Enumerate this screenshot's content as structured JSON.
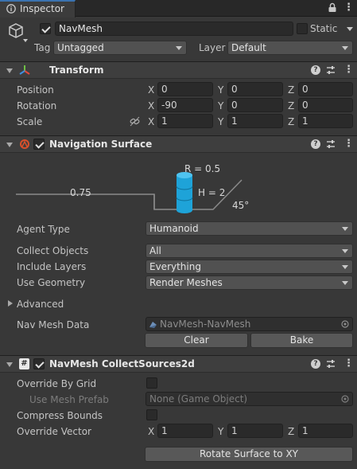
{
  "window": {
    "tab_title": "Inspector"
  },
  "gameobject": {
    "active": true,
    "name": "NavMesh",
    "static_label": "Static",
    "static_checked": false,
    "tag_label": "Tag",
    "tag_value": "Untagged",
    "layer_label": "Layer",
    "layer_value": "Default"
  },
  "transform": {
    "title": "Transform",
    "position": {
      "label": "Position",
      "x": "0",
      "y": "0",
      "z": "0"
    },
    "rotation": {
      "label": "Rotation",
      "x": "-90",
      "y": "0",
      "z": "0"
    },
    "scale": {
      "label": "Scale",
      "x": "1",
      "y": "1",
      "z": "1"
    },
    "axis_x": "X",
    "axis_y": "Y",
    "axis_z": "Z"
  },
  "nav_surface": {
    "title": "Navigation Surface",
    "enabled": true,
    "diagram": {
      "radius": "R = 0.5",
      "height": "H = 2",
      "step": "0.75",
      "slope": "45°"
    },
    "agent_type": {
      "label": "Agent Type",
      "value": "Humanoid"
    },
    "collect_objects": {
      "label": "Collect Objects",
      "value": "All"
    },
    "include_layers": {
      "label": "Include Layers",
      "value": "Everything"
    },
    "use_geometry": {
      "label": "Use Geometry",
      "value": "Render Meshes"
    },
    "advanced_label": "Advanced",
    "nav_mesh_data": {
      "label": "Nav Mesh Data",
      "value": "NavMesh-NavMesh"
    },
    "clear_label": "Clear",
    "bake_label": "Bake"
  },
  "collect_sources": {
    "title": "NavMesh CollectSources2d",
    "enabled": true,
    "override_by_grid": {
      "label": "Override By Grid",
      "checked": false
    },
    "use_mesh_prefab": {
      "label": "Use Mesh Prefab",
      "value": "None (Game Object)"
    },
    "compress_bounds": {
      "label": "Compress Bounds",
      "checked": false
    },
    "override_vector": {
      "label": "Override Vector",
      "x": "1",
      "y": "1",
      "z": "1"
    },
    "rotate_label": "Rotate Surface to XY"
  },
  "colors": {
    "accent": "#3a72b0",
    "panel": "#383838",
    "cylinder": "#1ea3d8"
  }
}
